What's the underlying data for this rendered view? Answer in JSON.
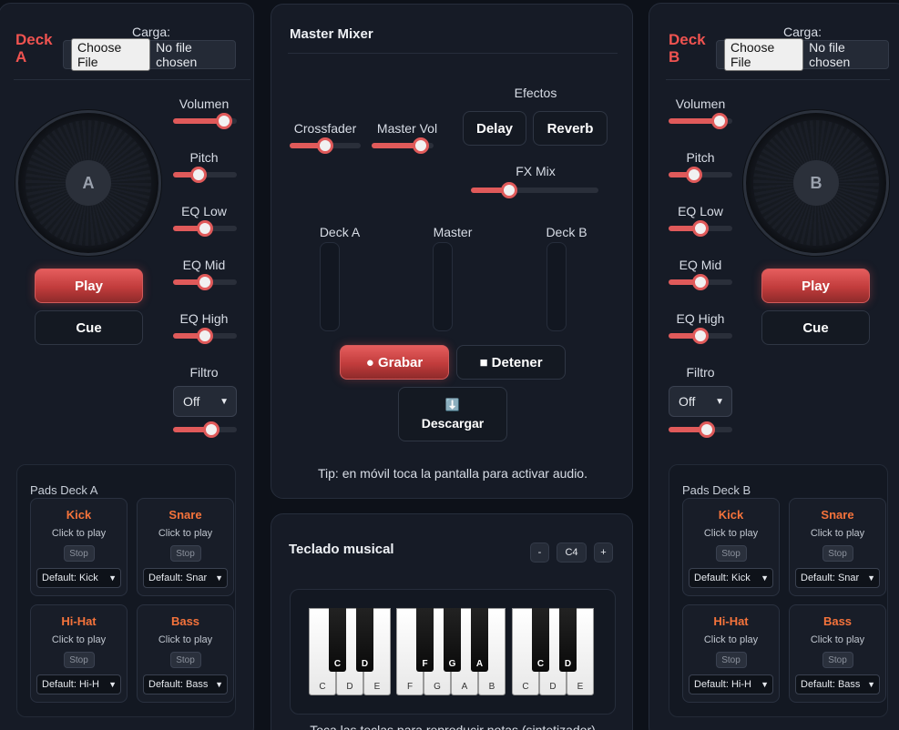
{
  "deckA": {
    "title": "Deck A",
    "title_line1": "Deck",
    "title_line2": "A",
    "load_label": "Carga:",
    "file_button": "Choose File",
    "file_status": "No file chosen",
    "jog_label": "A",
    "play": "Play",
    "cue": "Cue",
    "controls": {
      "volume": {
        "label": "Volumen",
        "value": 0.8
      },
      "pitch": {
        "label": "Pitch",
        "value": 0.4
      },
      "eq_low": {
        "label": "EQ Low",
        "value": 0.5
      },
      "eq_mid": {
        "label": "EQ Mid",
        "value": 0.5
      },
      "eq_high": {
        "label": "EQ High",
        "value": 0.5
      },
      "filter": {
        "label": "Filtro",
        "option": "Off",
        "value": 0.6
      }
    },
    "pads": {
      "title": "Pads Deck A",
      "items": [
        {
          "name": "Kick",
          "hint": "Click to play",
          "stop": "Stop",
          "select": "Default: Kick"
        },
        {
          "name": "Snare",
          "hint": "Click to play",
          "stop": "Stop",
          "select": "Default: Snar"
        },
        {
          "name": "Hi-Hat",
          "hint": "Click to play",
          "stop": "Stop",
          "select": "Default: Hi-H"
        },
        {
          "name": "Bass",
          "hint": "Click to play",
          "stop": "Stop",
          "select": "Default: Bass"
        }
      ]
    }
  },
  "deckB": {
    "title_line1": "Deck",
    "title_line2": "B",
    "load_label": "Carga:",
    "file_button": "Choose File",
    "file_status": "No file chosen",
    "jog_label": "B",
    "play": "Play",
    "cue": "Cue",
    "controls": {
      "volume": {
        "label": "Volumen",
        "value": 0.8
      },
      "pitch": {
        "label": "Pitch",
        "value": 0.4
      },
      "eq_low": {
        "label": "EQ Low",
        "value": 0.5
      },
      "eq_mid": {
        "label": "EQ Mid",
        "value": 0.5
      },
      "eq_high": {
        "label": "EQ High",
        "value": 0.5
      },
      "filter": {
        "label": "Filtro",
        "option": "Off",
        "value": 0.6
      }
    },
    "pads": {
      "title": "Pads Deck B",
      "items": [
        {
          "name": "Kick",
          "hint": "Click to play",
          "stop": "Stop",
          "select": "Default: Kick"
        },
        {
          "name": "Snare",
          "hint": "Click to play",
          "stop": "Stop",
          "select": "Default: Snar"
        },
        {
          "name": "Hi-Hat",
          "hint": "Click to play",
          "stop": "Stop",
          "select": "Default: Hi-H"
        },
        {
          "name": "Bass",
          "hint": "Click to play",
          "stop": "Stop",
          "select": "Default: Bass"
        }
      ]
    }
  },
  "master": {
    "title": "Master Mixer",
    "effects_label": "Efectos",
    "crossfader_label": "Crossfader",
    "crossfader_value": 0.5,
    "master_vol_label": "Master Vol",
    "master_vol_value": 0.8,
    "delay": "Delay",
    "reverb": "Reverb",
    "fx_mix_label": "FX Mix",
    "fx_mix_value": 0.3,
    "meters": [
      "Deck A",
      "Master",
      "Deck B"
    ],
    "record": "● Grabar",
    "stop": "■ Detener",
    "download_icon": "⬇️",
    "download": "Descargar",
    "tip": "Tip: en móvil toca la pantalla para activar audio."
  },
  "keyboard": {
    "title": "Teclado musical",
    "octave_down": "-",
    "octave": "C4",
    "octave_up": "+",
    "white_keys": [
      "C",
      "D",
      "E",
      "F",
      "G",
      "A",
      "B",
      "C",
      "D",
      "E"
    ],
    "black_keys": [
      "C",
      "D",
      "F",
      "G",
      "A",
      "C",
      "D"
    ],
    "footer": "Toca las teclas para reproducir notas (sintetizador)"
  },
  "colors": {
    "accent": "#e05a5a",
    "pad_name": "#f5733b",
    "deck_title": "#ef5350",
    "background": "#0d1119",
    "panel": "#161b26"
  }
}
